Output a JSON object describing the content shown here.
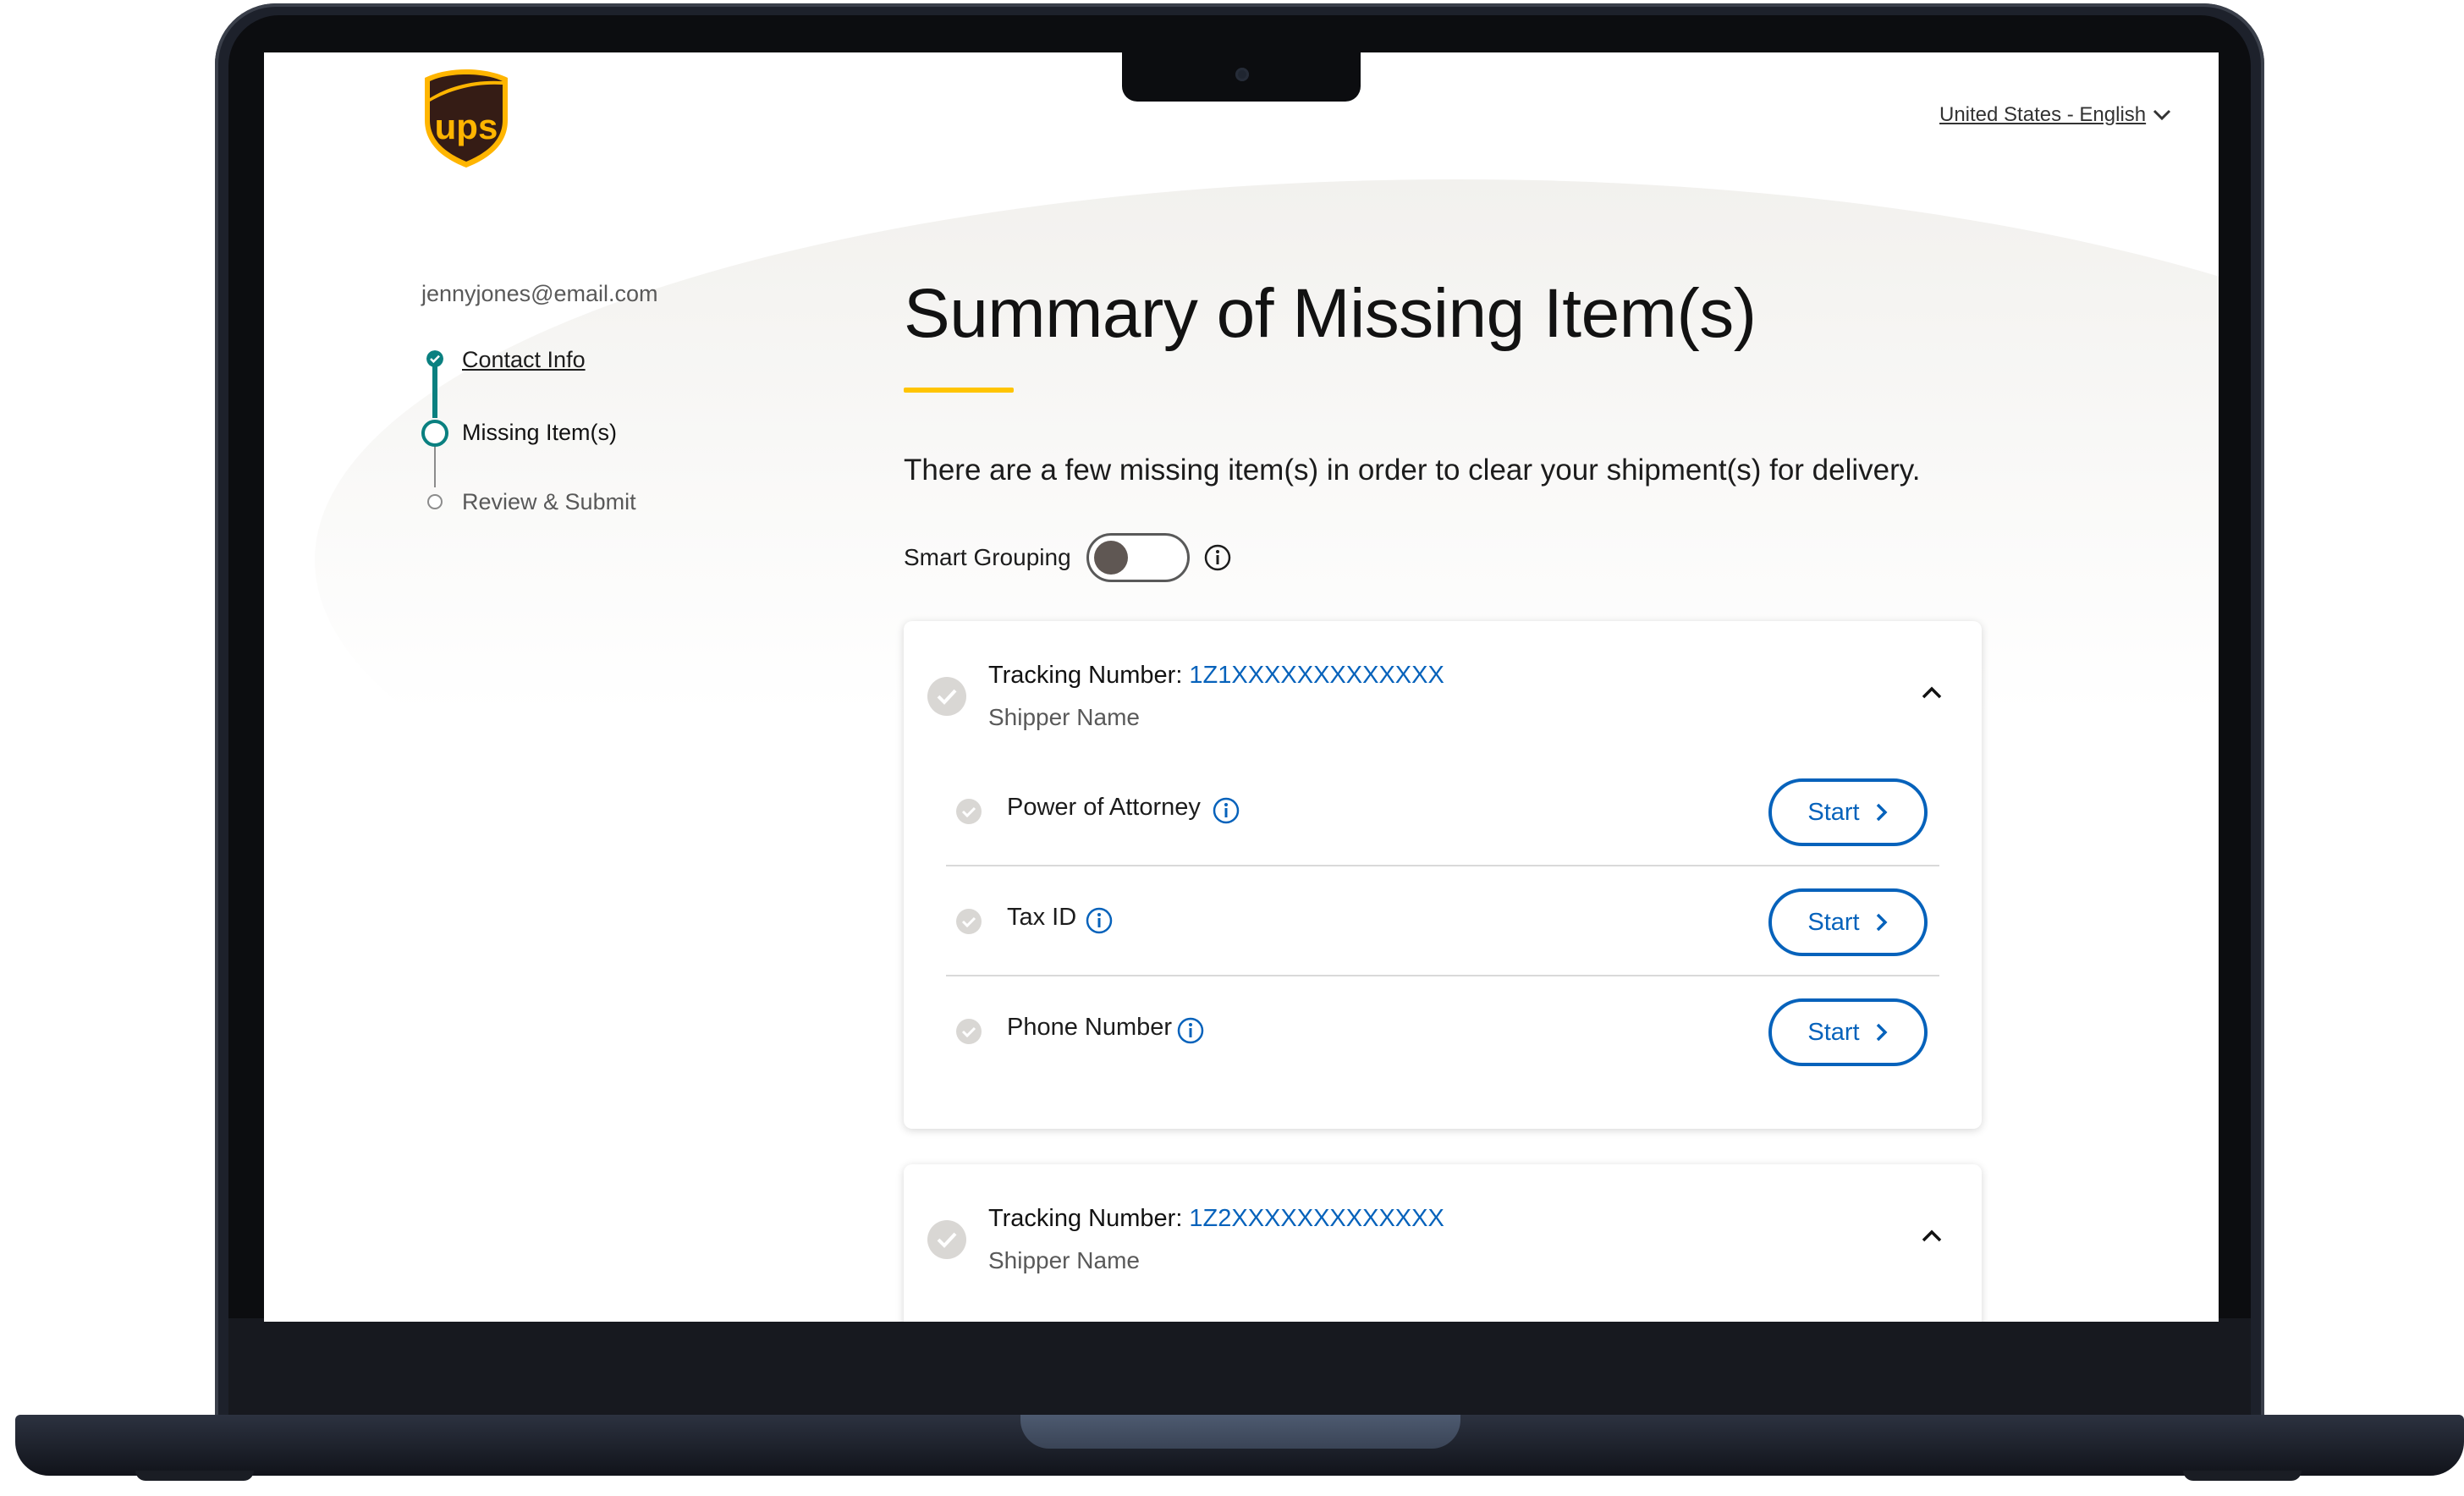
{
  "header": {
    "logo_text": "ups",
    "locale": "United States - English"
  },
  "sidebar": {
    "email": "jennyjones@email.com",
    "steps": [
      {
        "label": "Contact Info",
        "state": "complete"
      },
      {
        "label": "Missing Item(s)",
        "state": "current"
      },
      {
        "label": "Review & Submit",
        "state": "upcoming"
      }
    ]
  },
  "main": {
    "title": "Summary of Missing Item(s)",
    "intro": "There are a few missing item(s) in order to clear your shipment(s) for delivery.",
    "smart_grouping": {
      "label": "Smart Grouping",
      "enabled": false
    },
    "shipments": [
      {
        "tracking_label": "Tracking Number:",
        "tracking_number": "1Z1XXXXXXXXXXXXX",
        "shipper": "Shipper Name",
        "items": [
          {
            "label": "Power of Attorney",
            "button": "Start"
          },
          {
            "label": "Tax ID",
            "button": "Start"
          },
          {
            "label": "Phone Number",
            "button": "Start"
          }
        ]
      },
      {
        "tracking_label": "Tracking Number:",
        "tracking_number": "1Z2XXXXXXXXXXXXX",
        "shipper": "Shipper Name"
      }
    ]
  },
  "colors": {
    "accent_blue": "#0662bb",
    "brand_yellow": "#ffc400",
    "brand_brown": "#351c15",
    "stepper_teal": "#0a8080"
  }
}
